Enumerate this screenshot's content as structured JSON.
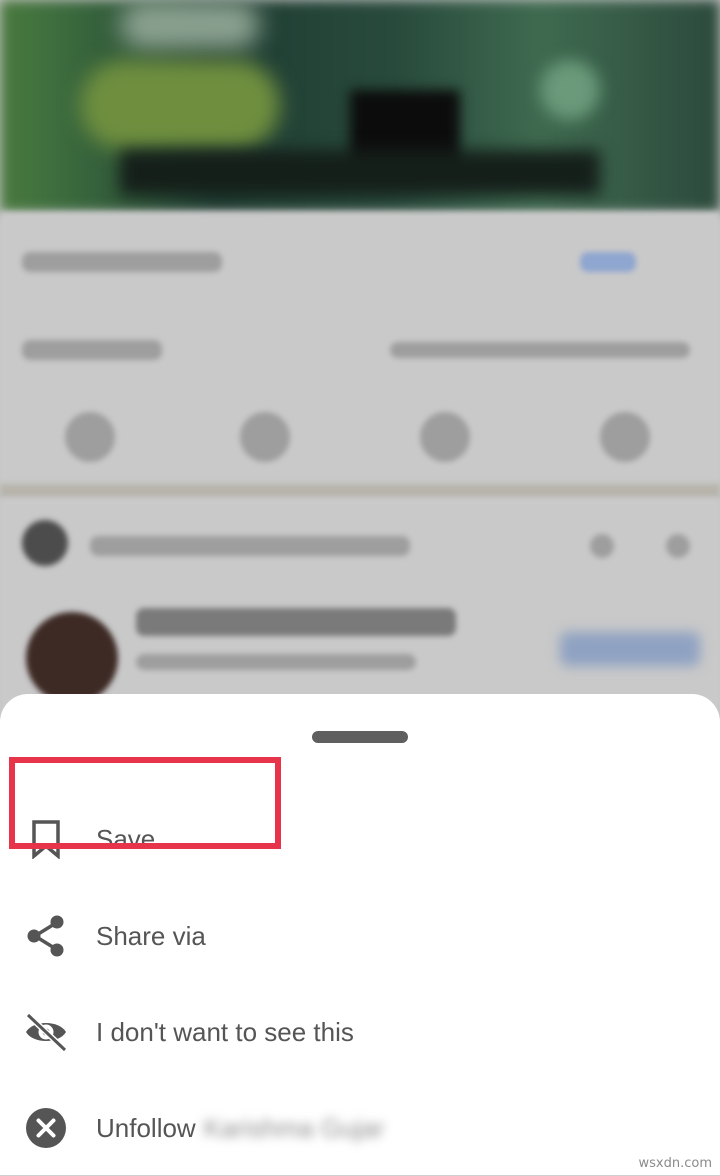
{
  "sheet": {
    "items": [
      {
        "label": "Save",
        "icon": "bookmark-icon"
      },
      {
        "label": "Share via",
        "icon": "share-icon"
      },
      {
        "label": "I don't want to see this",
        "icon": "eye-off-icon"
      },
      {
        "label": "Unfollow",
        "icon": "close-circle-icon",
        "name": "Karishma Gujar"
      }
    ]
  },
  "watermark": "wsxdn.com",
  "colors": {
    "highlight": "#e8344a",
    "icon": "#555555",
    "label": "#555555",
    "sheet": "#ffffff"
  }
}
